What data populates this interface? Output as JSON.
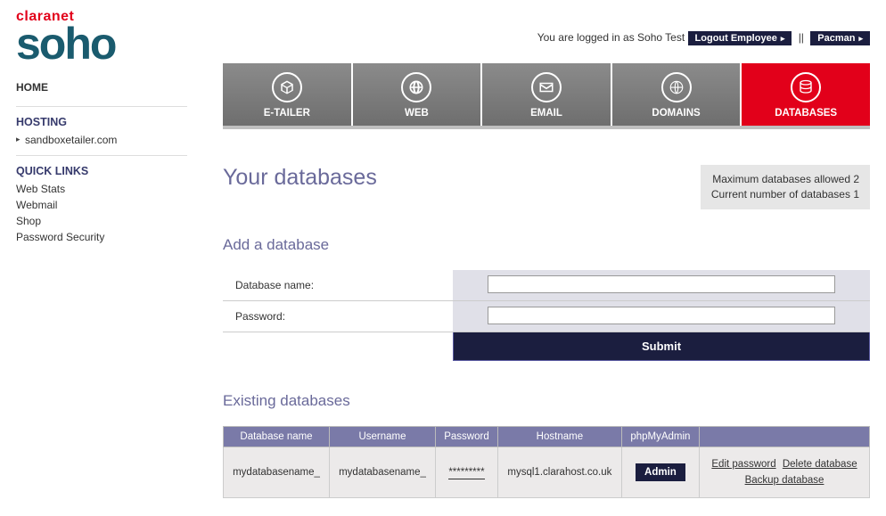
{
  "logo": {
    "top": "claranet",
    "bottom": "soho"
  },
  "sidebar": {
    "home": "HOME",
    "hosting": {
      "title": "HOSTING",
      "items": [
        "sandboxetailer.com"
      ]
    },
    "quicklinks": {
      "title": "QUICK LINKS",
      "items": [
        "Web Stats",
        "Webmail",
        "Shop",
        "Password Security"
      ]
    }
  },
  "topbar": {
    "logged_in_prefix": "You are logged in as ",
    "username": "Soho Test",
    "logout_label": "Logout Employee",
    "sep": "||",
    "pacman_label": "Pacman"
  },
  "tabs": [
    {
      "label": "E-TAILER",
      "icon": "cube-icon",
      "active": false
    },
    {
      "label": "WEB",
      "icon": "globe-icon",
      "active": false
    },
    {
      "label": "EMAIL",
      "icon": "mail-icon",
      "active": false
    },
    {
      "label": "DOMAINS",
      "icon": "network-icon",
      "active": false
    },
    {
      "label": "DATABASES",
      "icon": "database-icon",
      "active": true
    }
  ],
  "page": {
    "title": "Your databases",
    "status_line1": "Maximum databases allowed 2",
    "status_line2": "Current number of databases 1"
  },
  "add_form": {
    "title": "Add a database",
    "fields": {
      "db_name_label": "Database name:",
      "password_label": "Password:"
    },
    "submit_label": "Submit"
  },
  "existing": {
    "title": "Existing databases",
    "columns": [
      "Database name",
      "Username",
      "Password",
      "Hostname",
      "phpMyAdmin",
      ""
    ],
    "rows": [
      {
        "db_name": "mydatabasename_",
        "username": "mydatabasename_",
        "password_mask": "*********",
        "hostname": "mysql1.clarahost.co.uk",
        "admin_label": "Admin",
        "actions": {
          "edit": "Edit password",
          "delete": "Delete database",
          "backup": "Backup database"
        }
      }
    ]
  }
}
